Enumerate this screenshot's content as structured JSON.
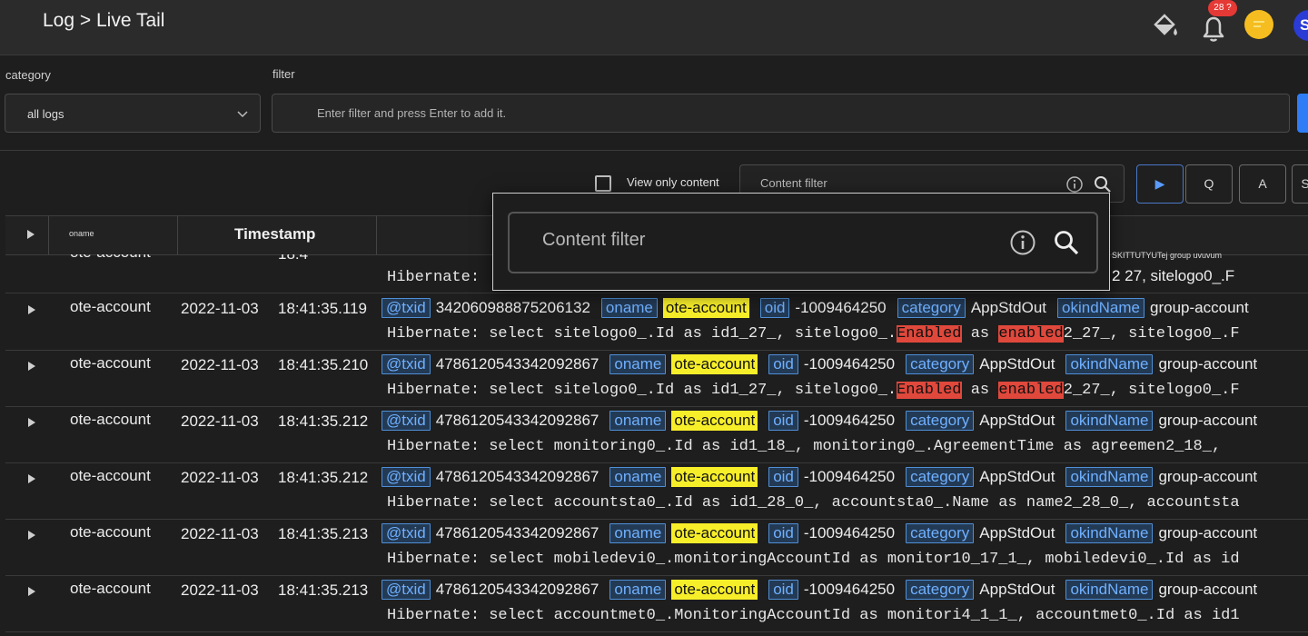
{
  "header": {
    "breadcrumb": "Log > Live Tail",
    "notification_count": "28 ?",
    "user_initial": "S"
  },
  "filters": {
    "category_label": "category",
    "category_value": "all logs",
    "filter_label": "filter",
    "filter_placeholder": "Enter filter and press Enter to add it."
  },
  "toolbar": {
    "view_only_label": "View only content",
    "content_filter_label": "Content filter",
    "play_label": "▶",
    "query_label": "Q",
    "auto_label": "A",
    "more_label": "S"
  },
  "table": {
    "columns": {
      "oname": "oname",
      "timestamp": "Timestamp"
    }
  },
  "tag_labels": {
    "txid": "@txid",
    "oname": "oname",
    "oid": "oid",
    "category": "category",
    "okindName": "okindName"
  },
  "rows": [
    {
      "oname": "ote-account",
      "date": "2022-11-03",
      "time": "18:41:35.119",
      "txid": "342060988875206132",
      "oname_value": "ote-account",
      "oid": "-1009464250",
      "category": "AppStdOut",
      "okindName": "group-account",
      "msg_before": "Hibernate: select sitelogo0_.Id as id1_27_, sitelogo0_.",
      "hl1": "Enabled",
      "msg_mid": " as ",
      "hl2": "enabled",
      "msg_after": "2_27_, sitelogo0_.F"
    },
    {
      "oname": "ote-account",
      "date": "2022-11-03",
      "time": "18:41:35.210",
      "txid": "4786120543342092867",
      "oname_value": "ote-account",
      "oid": "-1009464250",
      "category": "AppStdOut",
      "okindName": "group-account",
      "msg_before": "Hibernate: select sitelogo0_.Id as id1_27_, sitelogo0_.",
      "hl1": "Enabled",
      "msg_mid": " as ",
      "hl2": "enabled",
      "msg_after": "2_27_, sitelogo0_.F"
    },
    {
      "oname": "ote-account",
      "date": "2022-11-03",
      "time": "18:41:35.212",
      "txid": "4786120543342092867",
      "oname_value": "ote-account",
      "oid": "-1009464250",
      "category": "AppStdOut",
      "okindName": "group-account",
      "msg_before": "Hibernate: select monitoring0_.Id as id1_18_, monitoring0_.AgreementTime as agreemen2_18_,",
      "hl1": "",
      "msg_mid": "",
      "hl2": "",
      "msg_after": ""
    },
    {
      "oname": "ote-account",
      "date": "2022-11-03",
      "time": "18:41:35.212",
      "txid": "4786120543342092867",
      "oname_value": "ote-account",
      "oid": "-1009464250",
      "category": "AppStdOut",
      "okindName": "group-account",
      "msg_before": "Hibernate: select accountsta0_.Id as id1_28_0_, accountsta0_.Name as name2_28_0_, accountsta",
      "hl1": "",
      "msg_mid": "",
      "hl2": "",
      "msg_after": ""
    },
    {
      "oname": "ote-account",
      "date": "2022-11-03",
      "time": "18:41:35.213",
      "txid": "4786120543342092867",
      "oname_value": "ote-account",
      "oid": "-1009464250",
      "category": "AppStdOut",
      "okindName": "group-account",
      "msg_before": "Hibernate: select mobiledevi0_.monitoringAccountId as monitor10_17_1_, mobiledevi0_.Id as id",
      "hl1": "",
      "msg_mid": "",
      "hl2": "",
      "msg_after": ""
    },
    {
      "oname": "ote-account",
      "date": "2022-11-03",
      "time": "18:41:35.213",
      "txid": "4786120543342092867",
      "oname_value": "ote-account",
      "oid": "-1009464250",
      "category": "AppStdOut",
      "okindName": "group-account",
      "msg_before": "Hibernate: select accountmet0_.MonitoringAccountId as monitori4_1_1_, accountmet0_.Id as id1",
      "hl1": "",
      "msg_mid": "",
      "hl2": "",
      "msg_after": ""
    }
  ],
  "partial_row": {
    "oname": "ote-account",
    "time": "18:4",
    "msg": "Hibernate:",
    "side_small": "SKITTUTYUTej group uvuvum",
    "side_value": "2 27, sitelogo0_.F"
  },
  "popup": {
    "placeholder": "Content filter"
  },
  "colors": {
    "tag_blue": "#6fb0ff",
    "highlight_yellow": "#f7ee2a",
    "highlight_red": "#e0483c",
    "accent": "#2e7df6",
    "badge_red": "#e53935"
  }
}
